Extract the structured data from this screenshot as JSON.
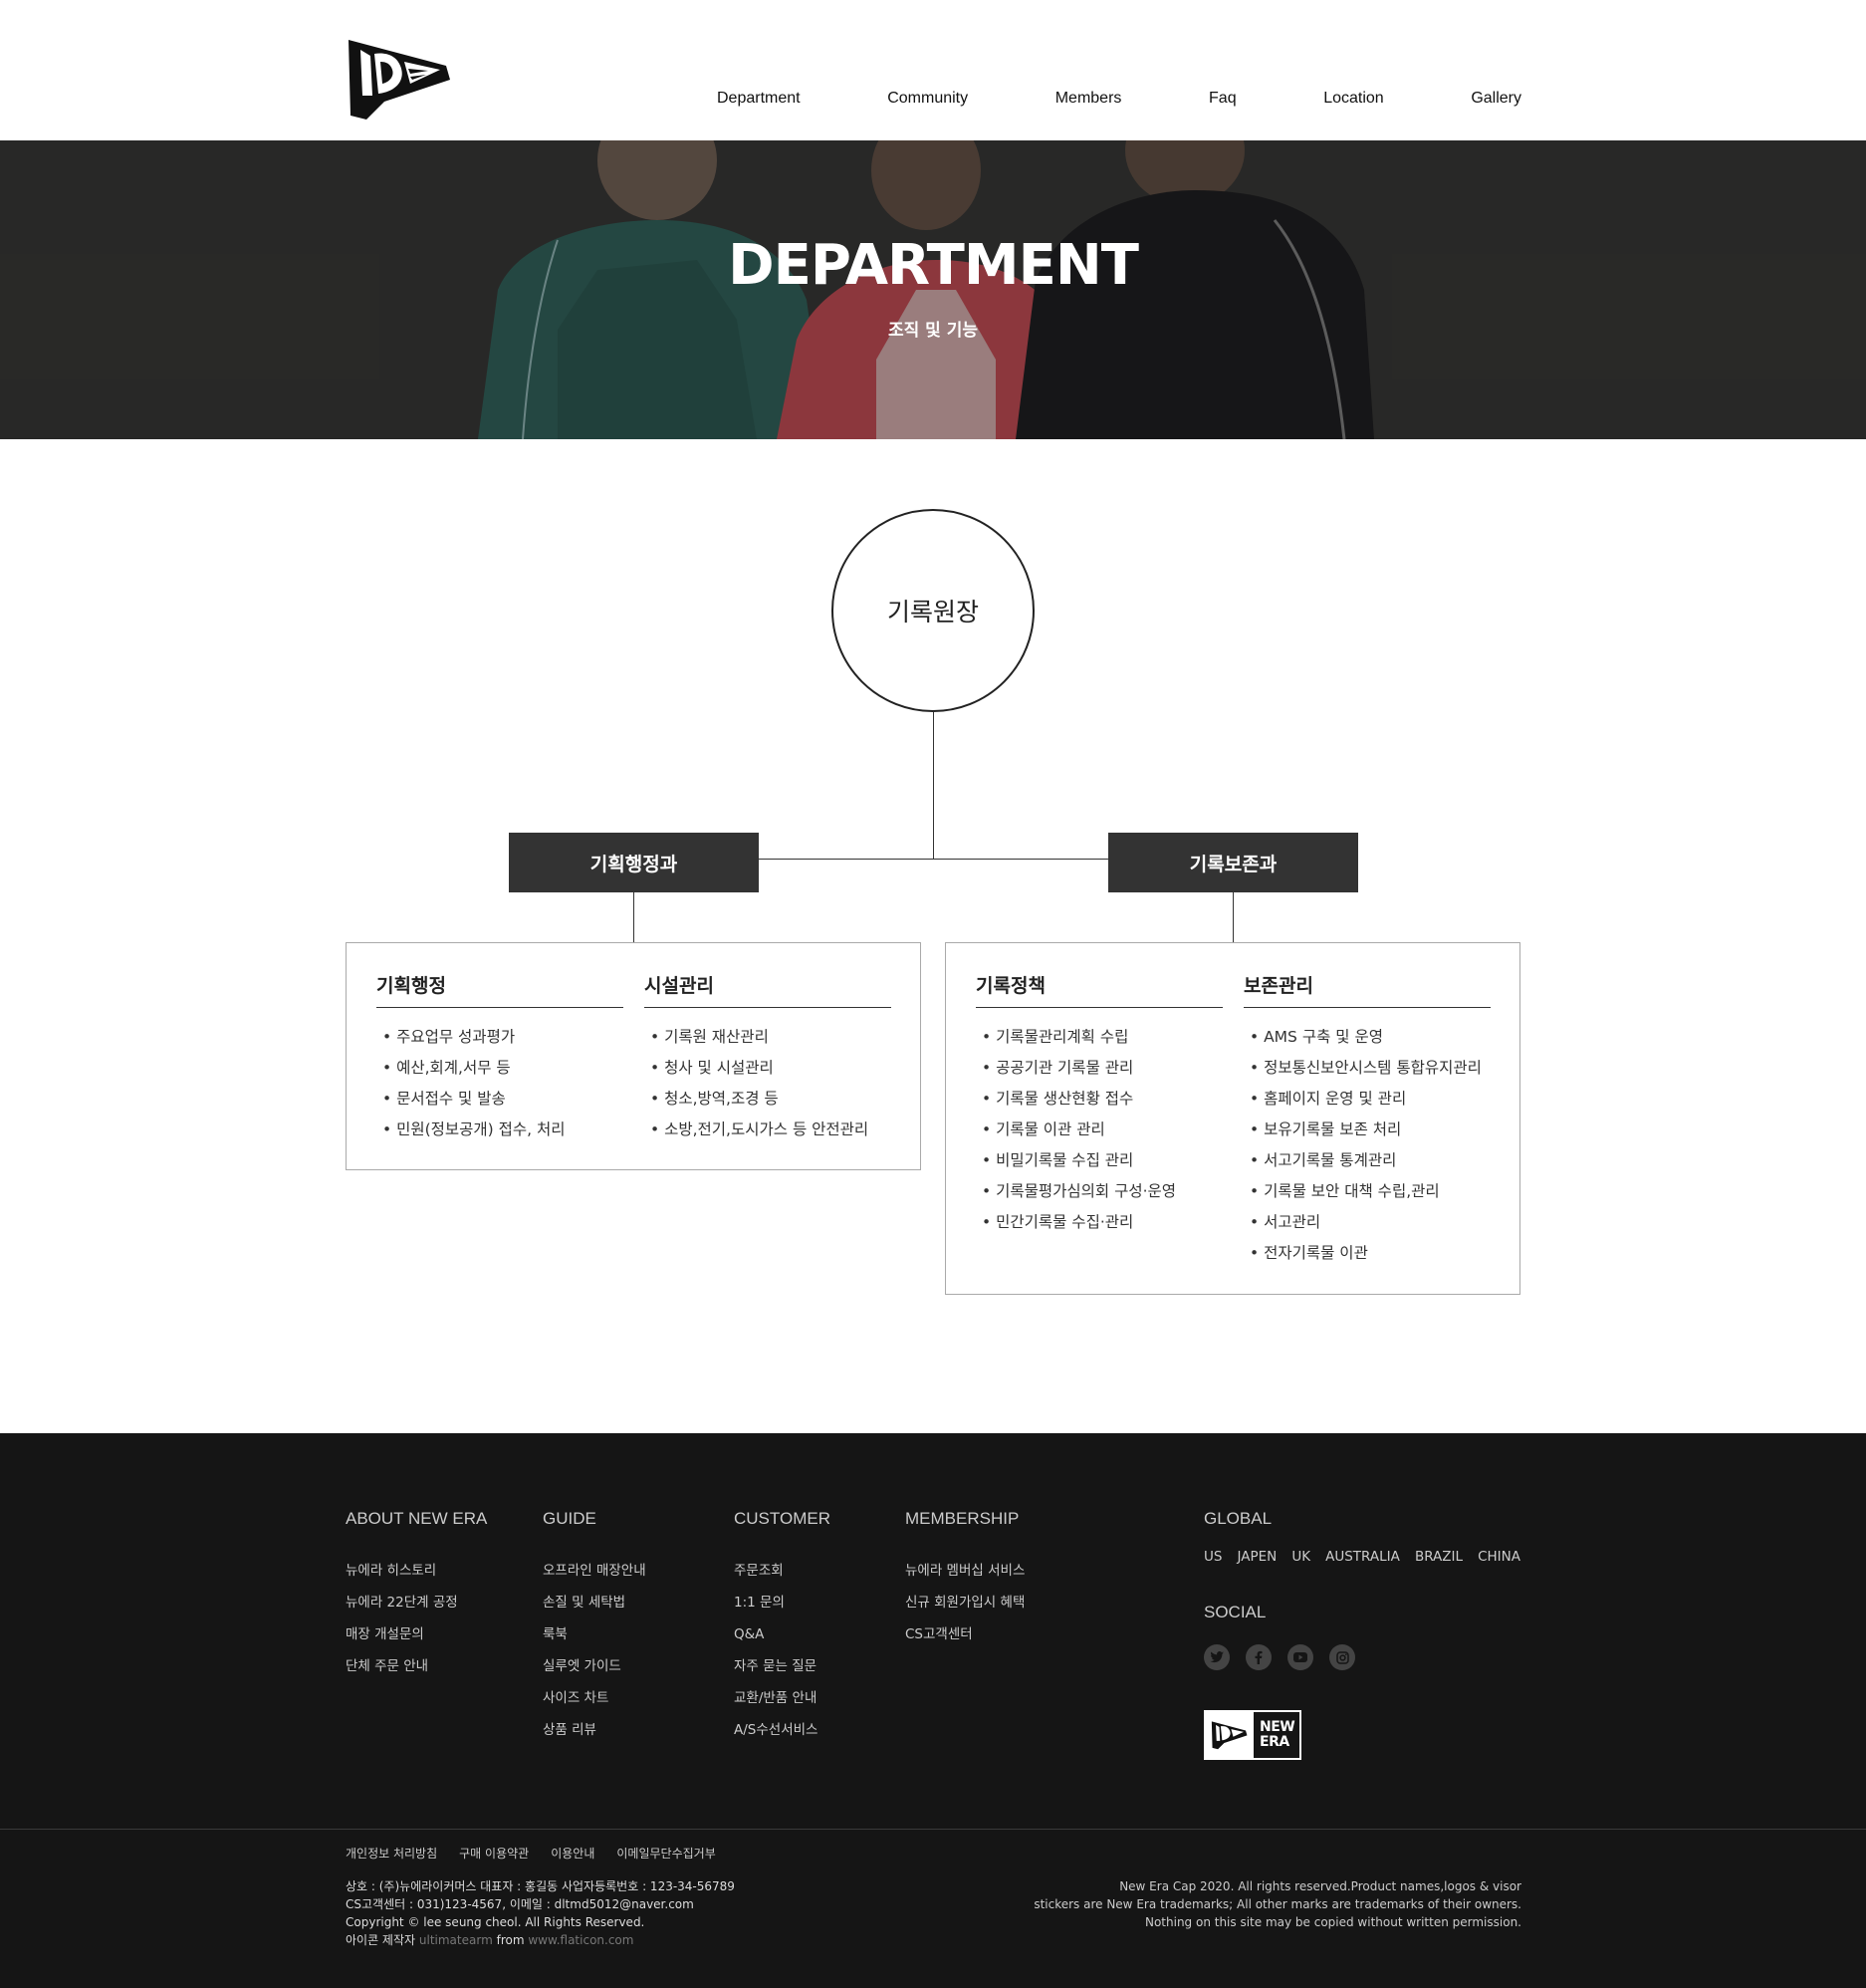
{
  "nav": {
    "items": [
      "Department",
      "Community",
      "Members",
      "Faq",
      "Location",
      "Gallery"
    ]
  },
  "hero": {
    "title": "DEPARTMENT",
    "subtitle": "조직 및 기능"
  },
  "org": {
    "head": "기록원장",
    "departments": [
      {
        "name": "기획행정과",
        "groups": [
          {
            "title": "기획행정",
            "items": [
              "주요업무 성과평가",
              "예산,회계,서무 등",
              "문서접수 및 발송",
              "민원(정보공개) 접수, 처리"
            ]
          },
          {
            "title": "시설관리",
            "items": [
              "기록원 재산관리",
              "청사 및 시설관리",
              "청소,방역,조경 등",
              "소방,전기,도시가스 등 안전관리"
            ]
          }
        ]
      },
      {
        "name": "기록보존과",
        "groups": [
          {
            "title": "기록정책",
            "items": [
              "기록물관리계획 수립",
              "공공기관 기록물 관리",
              "기록물 생산현황 접수",
              "기록물 이관 관리",
              "비밀기록물 수집 관리",
              "기록물평가심의회 구성·운영",
              "민간기록물 수집·관리"
            ]
          },
          {
            "title": "보존관리",
            "items": [
              "AMS 구축 및 운영",
              "정보통신보안시스템 통합유지관리",
              "홈페이지 운영 및 관리",
              "보유기록물 보존 처리",
              "서고기록물 통계관리",
              "기록물 보안 대책 수립,관리",
              "서고관리",
              "전자기록물 이관"
            ]
          }
        ]
      }
    ]
  },
  "footer": {
    "columns": [
      {
        "title": "ABOUT NEW ERA",
        "links": [
          "뉴에라 히스토리",
          "뉴에라 22단계 공정",
          "매장 개설문의",
          "단체 주문 안내"
        ]
      },
      {
        "title": "GUIDE",
        "links": [
          "오프라인 매장안내",
          "손질 및 세탁법",
          "룩북",
          "실루엣 가이드",
          "사이즈 차트",
          "상품 리뷰"
        ]
      },
      {
        "title": "CUSTOMER",
        "links": [
          "주문조회",
          "1:1 문의",
          "Q&A",
          "자주 묻는 질문",
          "교환/반품 안내",
          "A/S수선서비스"
        ]
      },
      {
        "title": "MEMBERSHIP",
        "links": [
          "뉴에라 멤버십 서비스",
          "신규 회원가입시 혜택",
          "CS고객센터"
        ]
      }
    ],
    "global": {
      "title": "GLOBAL",
      "countries": [
        "US",
        "JAPEN",
        "UK",
        "AUSTRALIA",
        "BRAZIL",
        "CHINA"
      ]
    },
    "social": {
      "title": "SOCIAL",
      "icons": [
        "twitter-icon",
        "facebook-icon",
        "youtube-icon",
        "instagram-icon"
      ]
    },
    "logo_text": [
      "NEW",
      "ERA"
    ],
    "legal_links": [
      "개인정보 처리방침",
      "구매 이용약관",
      "이용안내",
      "이메일무단수집거부"
    ],
    "info_lines": [
      "상호 : (주)뉴에라이커머스 대표자 : 홍길동 사업자등록번호 : 123-34-56789",
      "CS고객센터 : 031)123-4567, 이메일 : dltmd5012@naver.com",
      "Copyright © lee seung cheol. All Rights Reserved."
    ],
    "credit": {
      "prefix": "아이콘 제작자",
      "author": "ultimatearm",
      "from": "from",
      "site": "www.flaticon.com"
    },
    "copyright_lines": [
      "New Era Cap 2020. All rights reserved.Product names,logos & visor",
      "stickers are New Era trademarks; All other marks are trademarks of their owners.",
      "Nothing on this site may be copied without written permission."
    ]
  }
}
